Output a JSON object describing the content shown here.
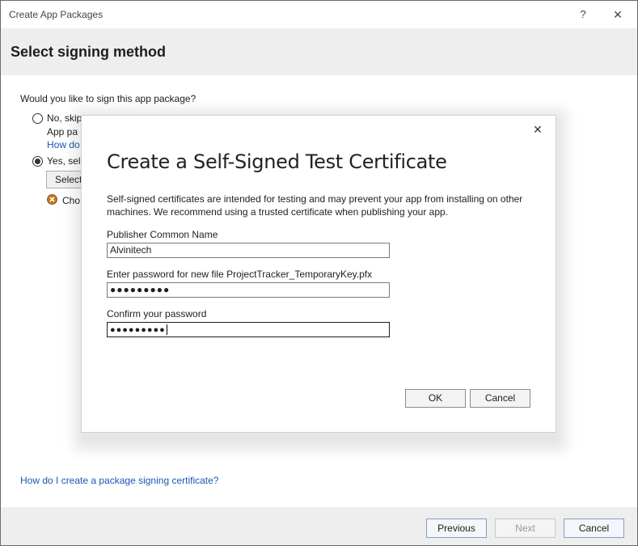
{
  "window": {
    "title": "Create App Packages",
    "help_glyph": "?",
    "close_glyph": "✕"
  },
  "header": {
    "heading": "Select signing method"
  },
  "main": {
    "question": "Would you like to sign this app package?",
    "option_no_line1": "No, skip",
    "option_no_line2": "App pa",
    "option_no_link": "How do",
    "option_yes": "Yes, sele",
    "select_button": "Select",
    "warning_text": "Cho",
    "warning_icon": "warning-badge-icon"
  },
  "bottom_link": "How do I create a package signing certificate?",
  "footer": {
    "previous": "Previous",
    "next": "Next",
    "cancel": "Cancel"
  },
  "dialog": {
    "title": "Create a Self-Signed Test Certificate",
    "close_glyph": "✕",
    "description": "Self-signed certificates are intended for testing and may prevent your app from installing on other machines. We recommend using a trusted certificate when publishing your app.",
    "publisher_label": "Publisher Common Name",
    "publisher_value": "Alvinitech",
    "password_label": "Enter password for new file ProjectTracker_TemporaryKey.pfx",
    "password_value": "●●●●●●●●●",
    "confirm_label": "Confirm your password",
    "confirm_value": "●●●●●●●●●",
    "ok": "OK",
    "cancel": "Cancel"
  },
  "colors": {
    "link": "#1a56b6",
    "header_bg": "#eeeeee",
    "warning": "#c8761e"
  }
}
